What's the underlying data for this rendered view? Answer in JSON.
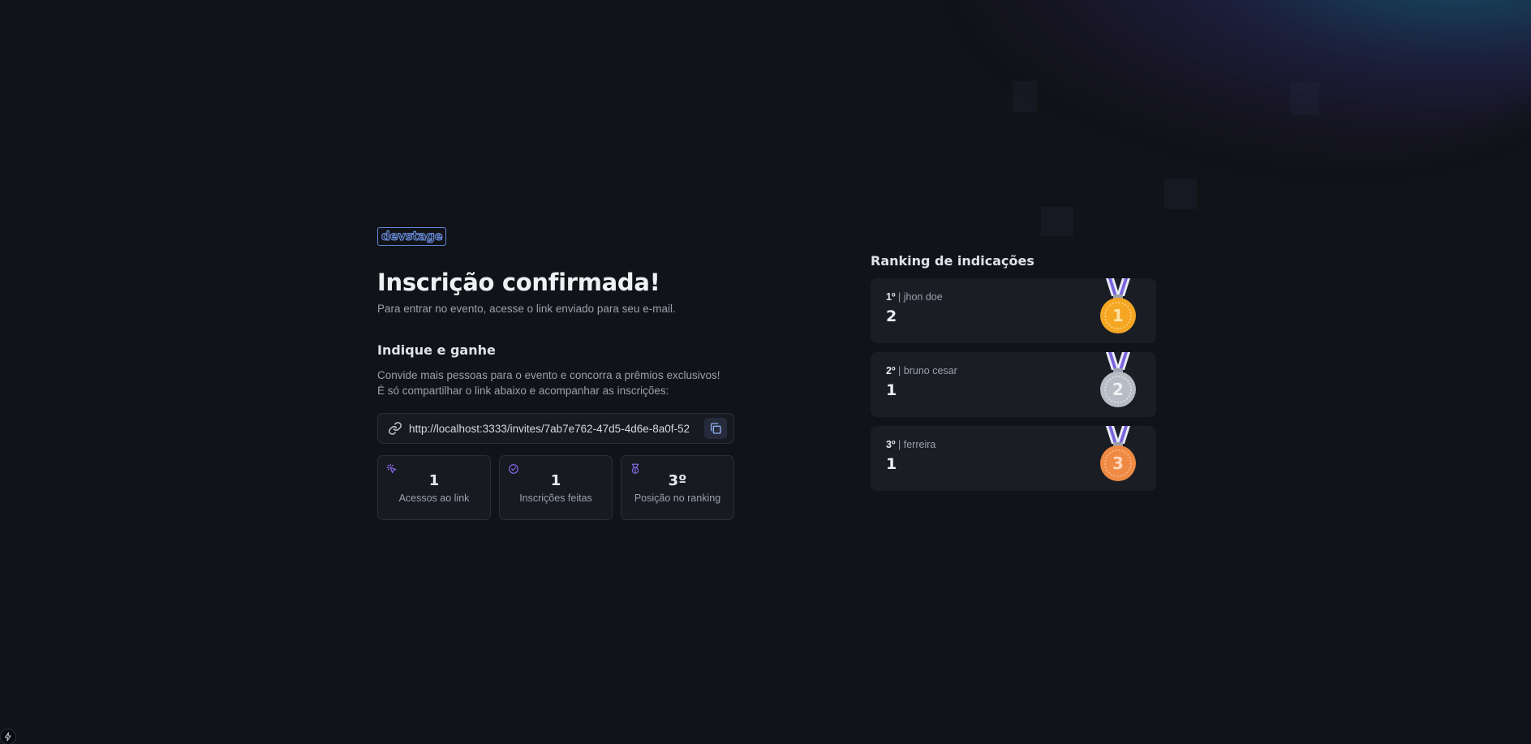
{
  "brand": {
    "logo_text": "devstage"
  },
  "confirmation": {
    "title": "Inscrição confirmada!",
    "subtitle": "Para entrar no evento, acesse o link enviado para seu e-mail."
  },
  "referral": {
    "title": "Indique e ganhe",
    "line1": "Convide mais pessoas para o evento e concorra a prêmios exclusivos!",
    "line2": "É só compartilhar o link abaixo e acompanhar as inscrições:",
    "invite_link": "http://localhost:3333/invites/7ab7e762-47d5-4d6e-8a0f-52"
  },
  "stats": [
    {
      "value": "1",
      "label": "Acessos ao link",
      "icon": "cursor-click-icon"
    },
    {
      "value": "1",
      "label": "Inscrições feitas",
      "icon": "badge-check-icon"
    },
    {
      "value": "3º",
      "label": "Posição no ranking",
      "icon": "medal-icon"
    }
  ],
  "ranking": {
    "title": "Ranking de indicações",
    "items": [
      {
        "position": "1º",
        "name": "jhon doe",
        "score": "2",
        "medal_number": "1",
        "medal_color": "#f5a623"
      },
      {
        "position": "2º",
        "name": "bruno cesar",
        "score": "1",
        "medal_number": "2",
        "medal_color": "#b8bcc4"
      },
      {
        "position": "3º",
        "name": "ferreira",
        "score": "1",
        "medal_number": "3",
        "medal_color": "#ee8a44"
      }
    ]
  },
  "colors": {
    "background": "#111318",
    "accent_purple": "#8b6cf0",
    "accent_blue": "#6f94e4"
  }
}
